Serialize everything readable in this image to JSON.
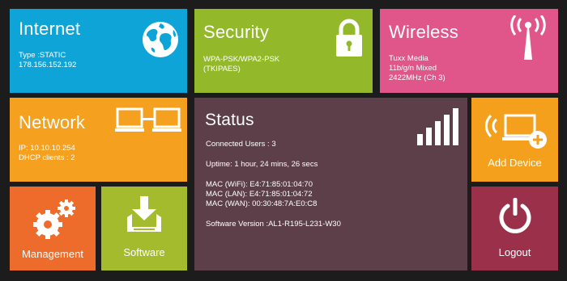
{
  "tiles": {
    "internet": {
      "title": "Internet",
      "type_line": "Type :STATIC",
      "ip": "178.156.152.192",
      "icon": "globe-icon",
      "color": "#0fa4d8"
    },
    "security": {
      "title": "Security",
      "line1": "WPA-PSK/WPA2-PSK",
      "line2": "(TKIPAES)",
      "icon": "padlock-icon",
      "color": "#93b92a"
    },
    "wireless": {
      "title": "Wireless",
      "line1": "Tuxx Media",
      "line2": "11b/g/n Mixed",
      "line3": "2422MHz (Ch 3)",
      "icon": "antenna-icon",
      "color": "#e0568a"
    },
    "network": {
      "title": "Network",
      "line1": "IP: 10.10.10.254",
      "line2": "DHCP clients : 2",
      "icon": "connected-laptops-icon",
      "color": "#f5a01e"
    },
    "status": {
      "title": "Status",
      "connected_users": "Connected Users : 3",
      "uptime": "Uptime: 1 hour, 24 mins, 26 secs",
      "mac_wifi": "MAC (WiFi): E4:71:85:01:04:70",
      "mac_lan": "MAC (LAN): E4:71:85:01:04:72",
      "mac_wan": "MAC (WAN): 00:30:48:7A:E0:C8",
      "software_version": "Software Version :AL1-R195-L231-W30",
      "icon": "signal-bars-icon",
      "color": "#5c3f48"
    },
    "add_device": {
      "label": "Add Device",
      "icon": "add-device-icon",
      "color": "#f4a01d"
    },
    "management": {
      "label": "Management",
      "icon": "gears-icon",
      "color": "#ee6c2b"
    },
    "software": {
      "label": "Software",
      "icon": "download-tray-icon",
      "color": "#a3bb2c"
    },
    "logout": {
      "label": "Logout",
      "icon": "power-icon",
      "color": "#9a3049"
    }
  }
}
